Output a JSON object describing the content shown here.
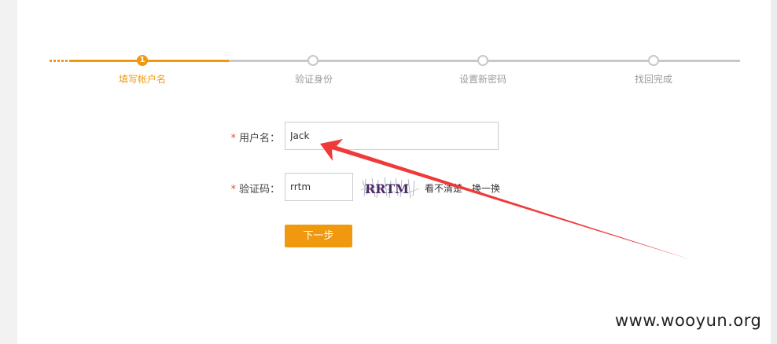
{
  "steps": [
    {
      "label": "填写帐户名",
      "badge": "1",
      "active": true
    },
    {
      "label": "验证身份",
      "active": false
    },
    {
      "label": "设置新密码",
      "active": false
    },
    {
      "label": "找回完成",
      "active": false
    }
  ],
  "form": {
    "required_mark": "*",
    "username": {
      "label": "用户名：",
      "value": "Jack"
    },
    "captcha": {
      "label": "验证码：",
      "value": "rrtm",
      "image_text": "RRTM",
      "unclear_link": "看不清楚",
      "refresh_link": "换一换"
    },
    "next_button": "下一步"
  },
  "annotation": {
    "color": "#f03a3a"
  },
  "watermark": "www.wooyun.org",
  "colors": {
    "accent": "#f0990f",
    "inactive": "#c8c8c8",
    "required": "#e8541a"
  }
}
